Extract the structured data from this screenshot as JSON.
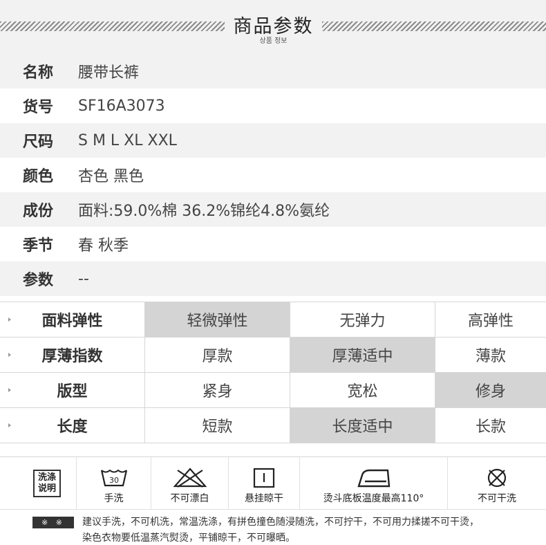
{
  "header": {
    "title": "商品参数",
    "subtitle": "상품 정보"
  },
  "info": [
    {
      "label": "名称",
      "value": "腰带长裤"
    },
    {
      "label": "货号",
      "value": "SF16A3073"
    },
    {
      "label": "尺码",
      "value": "S M L XL XXL"
    },
    {
      "label": "颜色",
      "value": "杏色 黑色"
    },
    {
      "label": "成份",
      "value": "面料:59.0%棉 36.2%锦纶4.8%氨纶"
    },
    {
      "label": "季节",
      "value": "春 秋季"
    },
    {
      "label": "参数",
      "value": "--"
    }
  ],
  "rating": [
    {
      "label": "面料弹性",
      "options": [
        "轻微弹性",
        "无弹力",
        "高弹性"
      ],
      "selected_index": 0
    },
    {
      "label": "厚薄指数",
      "options": [
        "厚款",
        "厚薄适中",
        "薄款"
      ],
      "selected_index": 1
    },
    {
      "label": "版型",
      "options": [
        "紧身",
        "宽松",
        "修身"
      ],
      "selected_index": 2
    },
    {
      "label": "长度",
      "options": [
        "短款",
        "长度适中",
        "长款"
      ],
      "selected_index": 1
    }
  ],
  "care": {
    "badge_line1": "洗涤",
    "badge_line2": "说明",
    "wash_temp": "30",
    "icons": [
      {
        "icon": "hand-wash-icon",
        "label": "手洗"
      },
      {
        "icon": "no-bleach-icon",
        "label": "不可漂白"
      },
      {
        "icon": "hang-dry-icon",
        "label": "悬挂晾干"
      },
      {
        "icon": "iron-icon",
        "label": "烫斗底板温度最高110°"
      },
      {
        "icon": "no-dry-clean-icon",
        "label": "不可干洗"
      }
    ],
    "note_mark": "※ ※",
    "note_line1": "建议手洗，不可机洗，常温洗涤，有拼色撞色随浸随洗，不可拧干，不可用力揉搓不可干烫，",
    "note_line2": "染色衣物要低温蒸汽熨烫，平铺晾干，不可曝晒。"
  }
}
